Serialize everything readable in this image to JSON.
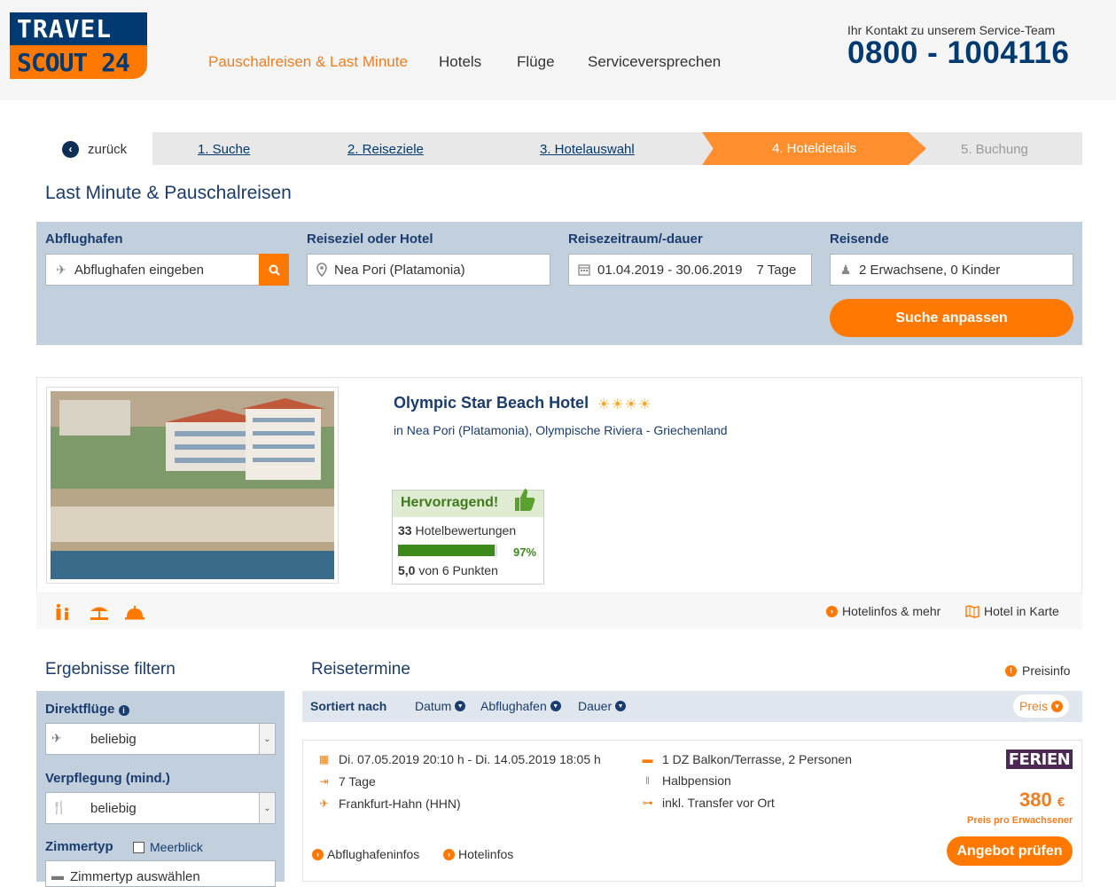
{
  "logo": {
    "line1": "TRAVEL",
    "line2": "SCOUT 24"
  },
  "nav": {
    "items": [
      {
        "label": "Pauschalreisen & Last Minute"
      },
      {
        "label": "Hotels"
      },
      {
        "label": "Flüge"
      },
      {
        "label": "Serviceversprechen"
      }
    ]
  },
  "contact": {
    "label": "Ihr Kontakt zu unserem Service-Team",
    "phone": "0800 - 1004116"
  },
  "steps": {
    "back": "zurück",
    "items": [
      "1. Suche",
      "2. Reiseziele",
      "3. Hotelauswahl",
      "4. Hoteldetails",
      "5. Buchung"
    ]
  },
  "page_title": "Last Minute & Pauschalreisen",
  "search": {
    "departure_label": "Abflughafen",
    "departure_placeholder": "Abflughafen eingeben",
    "destination_label": "Reiseziel oder Hotel",
    "destination_value": "Nea Pori (Platamonia)",
    "period_label": "Reisezeitraum/-dauer",
    "period_value": "01.04.2019 - 30.06.2019",
    "duration_value": "7 Tage",
    "travelers_label": "Reisende",
    "travelers_value": "2 Erwachsene, 0 Kinder",
    "submit": "Suche anpassen"
  },
  "hotel": {
    "name": "Olympic Star Beach Hotel",
    "stars": "☀☀☀☀",
    "location": "in Nea Pori (Platamonia), Olympische Riviera - Griechenland",
    "rating_title": "Hervorragend!",
    "review_count": "33",
    "review_label": "Hotelbewertungen",
    "recommend_pct": 97,
    "recommend_label": "97%",
    "score": "5,0",
    "score_label": "von 6 Punkten",
    "link_info": "Hotelinfos & mehr",
    "link_map": "Hotel in Karte"
  },
  "filter": {
    "title": "Ergebnisse filtern",
    "direct_label": "Direktflüge",
    "direct_value": "beliebig",
    "board_label": "Verpflegung (mind.)",
    "board_value": "beliebig",
    "room_label": "Zimmertyp",
    "seaview_label": "Meerblick",
    "room_placeholder": "Zimmertyp auswählen"
  },
  "results": {
    "title": "Reisetermine",
    "priceinfo": "Preisinfo",
    "sort_label": "Sortiert nach",
    "sort_items": [
      "Datum",
      "Abflughafen",
      "Dauer"
    ],
    "sort_active": "Preis"
  },
  "offer": {
    "dates": "Di. 07.05.2019 20:10 h - Di. 14.05.2019 18:05 h",
    "duration": "7 Tage",
    "airport": "Frankfurt-Hahn (HHN)",
    "room": "1 DZ Balkon/Terrasse, 2 Personen",
    "board": "Halbpension",
    "transfer": "inkl. Transfer vor Ort",
    "operator": "FERIEN",
    "price": "380",
    "currency": "€",
    "price_note": "Preis pro Erwachsener",
    "link_airport": "Abflughafeninfos",
    "link_hotel": "Hotelinfos",
    "cta": "Angebot prüfen"
  },
  "colors": {
    "brand_orange": "#ff7900",
    "brand_navy": "#003a70",
    "rating_green": "#3d8a1c"
  }
}
